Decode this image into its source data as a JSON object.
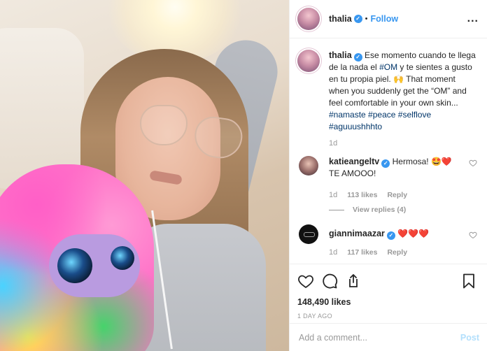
{
  "author": {
    "username": "thalia",
    "follow_label": "Follow",
    "dot": "•",
    "more_label": "..."
  },
  "caption": {
    "username": "thalia",
    "text_1": "Ese momento cuando te llega de la nada el ",
    "tag_om": "#OM",
    "text_2": " y te sientes a gusto en tu propia piel. ",
    "emoji": "🙌",
    "text_3": " That moment when you suddenly get the “OM” and feel comfortable in your own skin...",
    "tags": [
      "#namaste",
      "#peace",
      "#selflove",
      "#aguuushhhto"
    ],
    "time": "1d"
  },
  "comments": [
    {
      "username": "katieangeltv",
      "text": "Hermosa! 🤩❤️ TE AMOOO!",
      "time": "1d",
      "likes": "113 likes",
      "reply_label": "Reply",
      "view_replies": "View replies (4)"
    },
    {
      "username": "giannimaazar",
      "text": "❤️❤️❤️",
      "time": "1d",
      "likes": "117 likes",
      "reply_label": "Reply"
    }
  ],
  "actions": {
    "likes": "148,490 likes",
    "posted": "1 DAY AGO"
  },
  "add_comment": {
    "placeholder": "Add a comment...",
    "post_label": "Post"
  },
  "colors": {
    "link": "#3897f0",
    "hashtag": "#003569",
    "muted": "#999999",
    "post_disabled": "#b2dffc"
  },
  "icons": [
    "verified-badge-icon",
    "more-options-icon",
    "like-heart-icon",
    "comment-icon",
    "share-icon",
    "save-bookmark-icon",
    "comment-heart-icon"
  ]
}
